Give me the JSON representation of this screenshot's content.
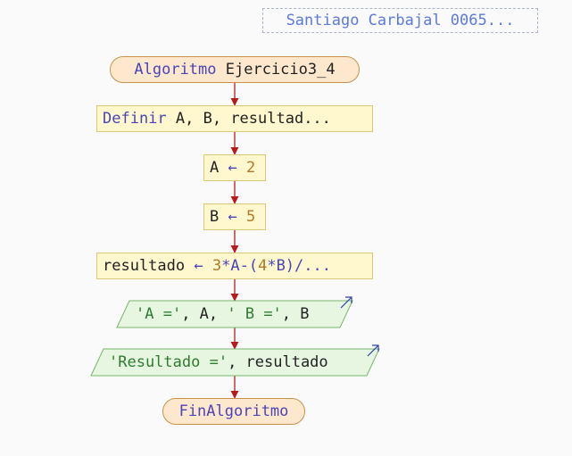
{
  "author_label": "Santiago Carbajal 0065...",
  "nodes": {
    "start": {
      "keyword": "Algoritmo",
      "name": "Ejercicio3_4"
    },
    "define": {
      "keyword": "Definir",
      "rest": "A, B, resultad..."
    },
    "assign_a": {
      "var": "A",
      "arrow": "←",
      "value": "2"
    },
    "assign_b": {
      "var": "B",
      "arrow": "←",
      "value": "5"
    },
    "assign_result": {
      "var": "resultado",
      "arrow": "←",
      "p1": "3",
      "p2": "*A-(",
      "p3": "4",
      "p4": "*B)/..."
    },
    "output_1": {
      "s1": "'A ='",
      "sep1": ", A, ",
      "s2": "' B ='",
      "sep2": ", B"
    },
    "output_2": {
      "s1": "'Resultado ='",
      "sep1": ", resultado"
    },
    "end": {
      "keyword": "FinAlgoritmo"
    }
  },
  "colors": {
    "edge": "#b71c1c",
    "terminal_fill": "#fde8cd",
    "process_fill": "#fff8cf",
    "io_fill": "#e6f6e1",
    "keyword": "#4a44b8",
    "string": "#2e7d2e",
    "number": "#b0782a"
  },
  "icons": [
    "output-arrow-icon"
  ]
}
